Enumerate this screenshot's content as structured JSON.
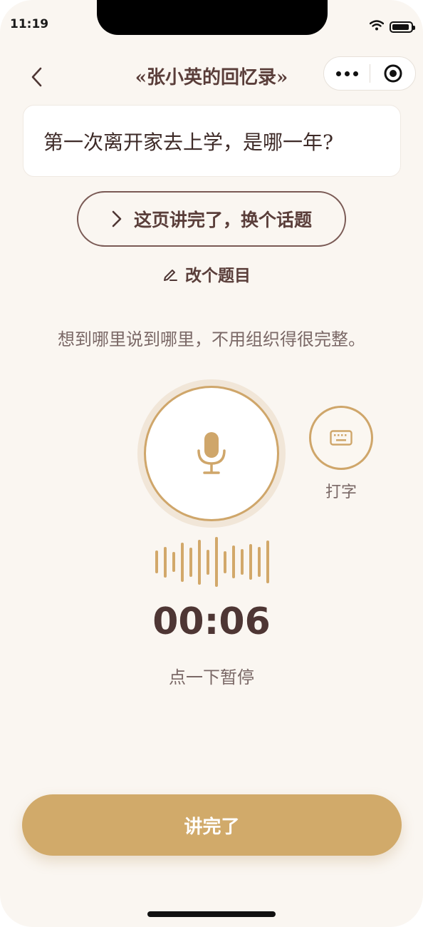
{
  "status_bar": {
    "time": "11:19",
    "battery_level": 0.9
  },
  "nav": {
    "title": "«张小英的回忆录»"
  },
  "question": {
    "text": "第一次离开家去上学，是哪一年?"
  },
  "actions": {
    "next_topic_label": "这页讲完了，换个话题",
    "change_question_label": "改个题目"
  },
  "hint": "想到哪里说到哪里，不用组织得很完整。",
  "recorder": {
    "keyboard_label": "打字",
    "timer": "00:06",
    "pause_hint": "点一下暂停",
    "wave_levels": [
      0.45,
      0.62,
      0.4,
      0.78,
      0.58,
      0.9,
      0.5,
      1.0,
      0.44,
      0.66,
      0.52,
      0.72,
      0.6,
      0.86
    ]
  },
  "footer": {
    "done_label": "讲完了"
  },
  "colors": {
    "accent": "#d1aa6a",
    "text_dark": "#4e3634",
    "background": "#faf6f1"
  }
}
